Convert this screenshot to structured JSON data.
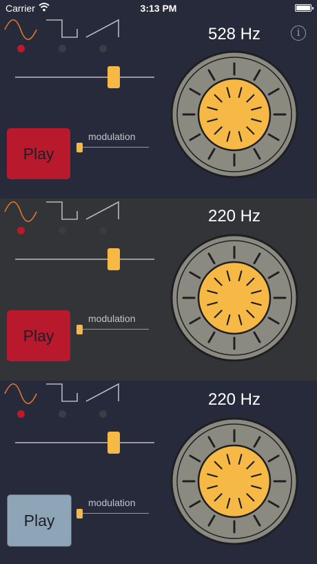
{
  "statusbar": {
    "carrier": "Carrier",
    "time": "3:13 PM"
  },
  "colors": {
    "background": "#262a3a",
    "background_selected": "#333438",
    "accent": "#f6b945",
    "wave_selected": "#e3782f",
    "wave_unselected": "#b8b8bf",
    "dot_selected": "#c4162b",
    "dot_unselected": "#3a3d47",
    "play_active": "#b8192d",
    "play_inactive": "#8ea4b7",
    "knob_outer": "#8a8a80",
    "knob_inner": "#f6b945"
  },
  "panels": [
    {
      "frequency": "528 Hz",
      "play_label": "Play",
      "modulation_label": "modulation",
      "selected_wave": "sine",
      "frequency_slider_fraction": 0.71,
      "modulation_slider_fraction": 0.0,
      "playing": true,
      "highlighted": false,
      "waveforms": [
        "sine",
        "square",
        "sawtooth"
      ]
    },
    {
      "frequency": "220 Hz",
      "play_label": "Play",
      "modulation_label": "modulation",
      "selected_wave": "sine",
      "frequency_slider_fraction": 0.71,
      "modulation_slider_fraction": 0.0,
      "playing": true,
      "highlighted": true,
      "waveforms": [
        "sine",
        "square",
        "sawtooth"
      ]
    },
    {
      "frequency": "220 Hz",
      "play_label": "Play",
      "modulation_label": "modulation",
      "selected_wave": "sine",
      "frequency_slider_fraction": 0.71,
      "modulation_slider_fraction": 0.0,
      "playing": false,
      "highlighted": false,
      "waveforms": [
        "sine",
        "square",
        "sawtooth"
      ]
    }
  ],
  "info_button": {
    "icon": "info-icon",
    "glyph": "i"
  }
}
